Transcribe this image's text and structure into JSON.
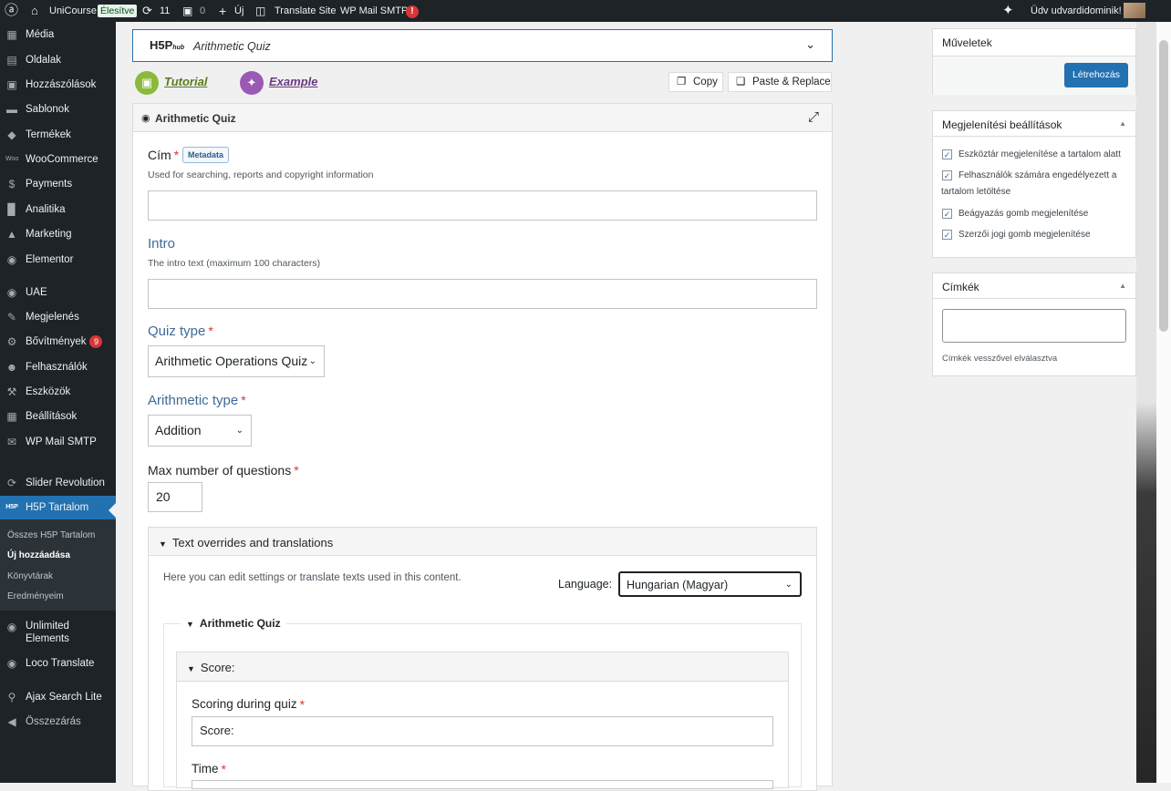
{
  "adminbar": {
    "site": "UniCourse",
    "live": "Élesítve",
    "updates": "11",
    "comments": "0",
    "new": "Új",
    "translate": "Translate Site",
    "smtp": "WP Mail SMTP",
    "smtp_badge": "!",
    "greeting": "Üdv udvardidominik!"
  },
  "sidebar": {
    "items": [
      {
        "label": "Média",
        "icon": "media-icon"
      },
      {
        "label": "Oldalak",
        "icon": "pages-icon"
      },
      {
        "label": "Hozzászólások",
        "icon": "comments-icon"
      },
      {
        "label": "Sablonok",
        "icon": "folder-icon"
      },
      {
        "label": "Termékek",
        "icon": "products-icon"
      },
      {
        "label": "WooCommerce",
        "icon": "woocommerce-icon"
      },
      {
        "label": "Payments",
        "icon": "payments-icon"
      },
      {
        "label": "Analitika",
        "icon": "analytics-icon"
      },
      {
        "label": "Marketing",
        "icon": "marketing-icon"
      },
      {
        "label": "Elementor",
        "icon": "elementor-icon"
      },
      {
        "label": "UAE",
        "icon": "uae-icon"
      },
      {
        "label": "Megjelenés",
        "icon": "appearance-icon"
      },
      {
        "label": "Bővítmények",
        "icon": "plugins-icon",
        "badge": "9"
      },
      {
        "label": "Felhasználók",
        "icon": "users-icon"
      },
      {
        "label": "Eszközök",
        "icon": "tools-icon"
      },
      {
        "label": "Beállítások",
        "icon": "settings-icon"
      },
      {
        "label": "WP Mail SMTP",
        "icon": "mail-icon"
      },
      {
        "label": "Slider Revolution",
        "icon": "slider-icon"
      },
      {
        "label": "H5P Tartalom",
        "icon": "h5p-icon"
      }
    ],
    "submenu": [
      "Összes H5P Tartalom",
      "Új hozzáadása",
      "Könyvtárak",
      "Eredményeim"
    ],
    "bottom": [
      {
        "label": "Unlimited",
        "label2": "Elements",
        "icon": "unlimited-elements-icon"
      },
      {
        "label": "Loco Translate",
        "icon": "loco-icon"
      },
      {
        "label": "Ajax Search Lite",
        "icon": "search-icon"
      },
      {
        "label": "Összezárás",
        "icon": "collapse-icon"
      }
    ]
  },
  "editor": {
    "hub_logo": "H5P",
    "hub_small": "hub",
    "content_type": "Arithmetic Quiz",
    "tutorial": "Tutorial",
    "example": "Example",
    "copy": "Copy",
    "paste": "Paste & Replace",
    "form_title": "Arithmetic Quiz",
    "cim_label": "Cím",
    "metadata": "Metadata",
    "cim_desc": "Used for searching, reports and copyright information",
    "cim_value": "",
    "intro_label": "Intro",
    "intro_desc": "The intro text (maximum 100 characters)",
    "intro_value": "",
    "quiz_type_label": "Quiz type",
    "quiz_type_value": "Arithmetic Operations Quiz",
    "arith_type_label": "Arithmetic type",
    "arith_type_value": "Addition",
    "max_q_label": "Max number of questions",
    "max_q_value": "20",
    "overrides_label": "Text overrides and translations",
    "overrides_desc": "Here you can edit settings or translate texts used in this content.",
    "language_label": "Language:",
    "language_value": "Hungarian (Magyar)",
    "group_label": "Arithmetic Quiz",
    "score_group": "Score:",
    "scoring_label": "Scoring during quiz",
    "scoring_value": "Score:",
    "time_label": "Time",
    "required_mark": "*"
  },
  "right": {
    "actions_title": "Műveletek",
    "create_btn": "Létrehozás",
    "display_title": "Megjelenítési beállítások",
    "checkboxes": [
      {
        "line1": "Eszköztár megjelenítése a tartalom alatt",
        "checked": true
      },
      {
        "line1": "Felhasználók számára engedélyezett a",
        "line2": "tartalom letöltése",
        "checked": true
      },
      {
        "line1": "Beágyazás gomb megjelenítése",
        "checked": true
      },
      {
        "line1": "Szerzői jogi gomb megjelenítése",
        "checked": true
      }
    ],
    "tags_title": "Címkék",
    "tags_hint": "Címkék vesszővel elválasztva"
  },
  "colors": {
    "accent": "#2271b1",
    "tutorial": "#8bb93c",
    "example": "#9b59b6",
    "required": "#d63638"
  }
}
